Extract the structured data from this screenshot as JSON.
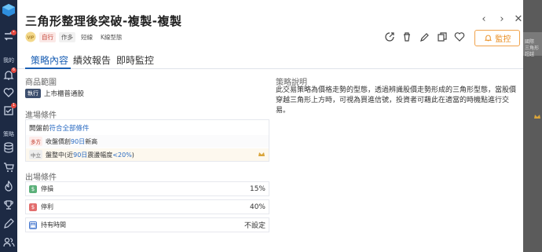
{
  "sidebar": {
    "label_mine": "我的",
    "label_strategy": "策略",
    "badge_bell": "6",
    "badge_check": "1"
  },
  "modal": {
    "title": "三角形整理後突破-複製-複製",
    "tags": {
      "self": "自行",
      "author": "作多",
      "t1": "短線",
      "t2": "K線型態"
    },
    "monitor_button": "監控",
    "tabs": [
      "策略內容",
      "績效報告",
      "即時監控"
    ]
  },
  "product_scope": {
    "heading": "商品範圍",
    "exec_tag": "執行",
    "text": "上市櫃普通股"
  },
  "description": {
    "heading": "策略說明",
    "text": "此交易策略為價格走勢的型態，透過辨識股價走勢形成的三角形型態，當股價穿越三角形上方時，可視為買進信號，投資者可藉此在適當的時機點進行交易。"
  },
  "entry": {
    "heading": "進場條件",
    "head_prefix": "開盤前",
    "head_link": "符合全部條件",
    "conditions": [
      {
        "tag": "多方",
        "pre": "收盤價創",
        "num": "90日",
        "post": "新高"
      },
      {
        "tag": "中立",
        "pre": "盤整中(近",
        "num": "90日",
        "mid": "震盪幅度",
        "num2": "<20%",
        "post": ")"
      }
    ]
  },
  "exit": {
    "heading": "出場條件",
    "rows": [
      {
        "icon": "$",
        "label": "停損",
        "value": "15%"
      },
      {
        "icon": "$",
        "label": "停利",
        "value": "40%"
      },
      {
        "icon": "",
        "label": "持有時間",
        "value": "不設定"
      }
    ]
  },
  "right_peek": {
    "t1": "國際",
    "t2": "三角形",
    "t3": "超越"
  },
  "colors": {
    "accent": "#1a5fb4",
    "monitor": "#e88a1a",
    "nav_bg": "#1d2a44"
  }
}
